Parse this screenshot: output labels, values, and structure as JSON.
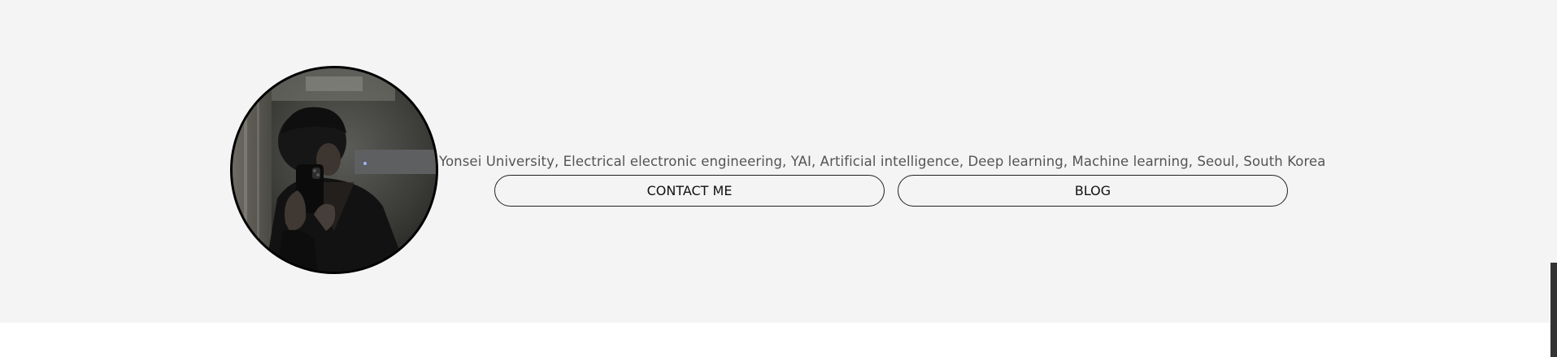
{
  "profile": {
    "tagline": "Yonsei University, Electrical electronic engineering, YAI, Artificial intelligence, Deep learning, Machine learning, Seoul, South Korea"
  },
  "buttons": {
    "contact_label": "CONTACT ME",
    "blog_label": "BLOG"
  },
  "colors": {
    "hero_background": "#f4f4f4",
    "page_background": "#ffffff",
    "text": "#545454",
    "button_border": "#222222",
    "scrollbar_thumb": "#333333"
  }
}
